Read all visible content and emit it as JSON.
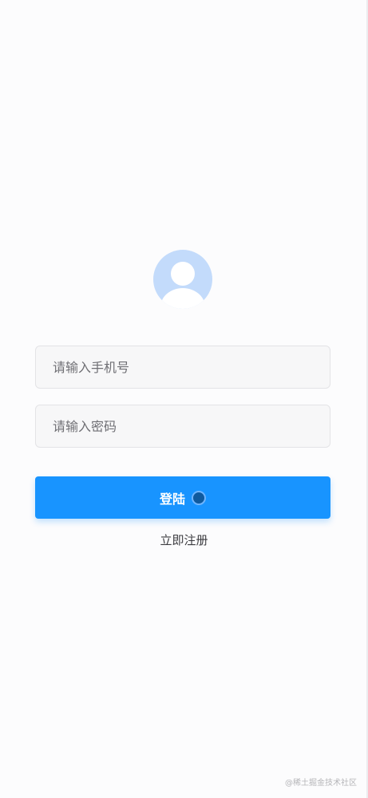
{
  "login_form": {
    "phone_placeholder": "请输入手机号",
    "password_placeholder": "请输入密码",
    "login_label": "登陆",
    "register_label": "立即注册"
  },
  "watermark": "@稀土掘金技术社区",
  "colors": {
    "accent": "#1894ff",
    "avatar": "#c3dbfb"
  }
}
